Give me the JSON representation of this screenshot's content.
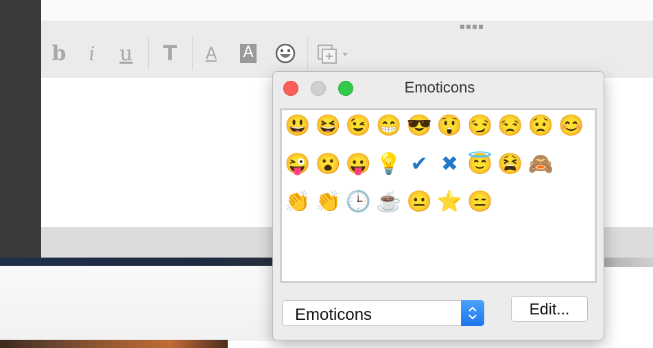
{
  "toolbar": {
    "buttons": [
      {
        "label": "b",
        "name": "bold-button"
      },
      {
        "label": "i",
        "name": "italic-button"
      },
      {
        "label": "u",
        "name": "underline-button"
      },
      {
        "label": "T",
        "name": "text-style-button"
      },
      {
        "label": "A",
        "name": "font-color-button"
      },
      {
        "label": "A",
        "name": "highlight-color-button"
      }
    ],
    "emoticon_icon": "smiley-icon",
    "insert_icon": "insert-image-icon"
  },
  "popup": {
    "title": "Emoticons",
    "category_value": "Emoticons",
    "edit_label": "Edit...",
    "emoticons": [
      [
        "😃",
        "😆",
        "😉",
        "😁",
        "😎",
        "😲",
        "😏",
        "😒",
        "😟",
        "😊"
      ],
      [
        "😜",
        "😮",
        "😛",
        "💡",
        "✔",
        "✖",
        "😇",
        "😫",
        "🙈"
      ],
      [
        "👏",
        "👏",
        "🕒",
        "☕",
        "😐",
        "⭐",
        "😑"
      ]
    ]
  },
  "colors": {
    "close": "#fc5f57",
    "minimize": "#d0d0d0",
    "zoom": "#34c84a",
    "select_accent": "#1d75ef"
  }
}
